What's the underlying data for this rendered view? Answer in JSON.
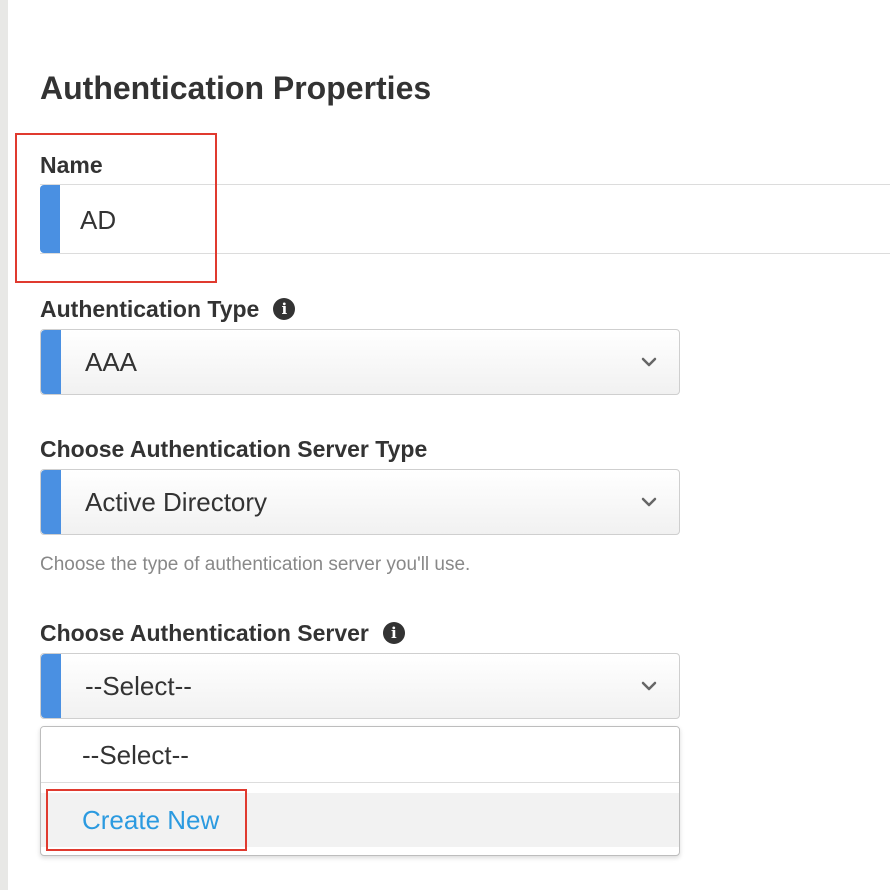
{
  "page": {
    "title": "Authentication Properties"
  },
  "name_field": {
    "label": "Name",
    "value": "AD"
  },
  "auth_type": {
    "label": "Authentication Type",
    "selected": "AAA",
    "info_icon": "info-icon"
  },
  "server_type": {
    "label": "Choose Authentication Server Type",
    "selected": "Active Directory",
    "help": "Choose the type of authentication server you'll use."
  },
  "server": {
    "label": "Choose Authentication Server",
    "selected": "--Select--",
    "info_icon": "info-icon",
    "options": [
      "--Select--",
      "Create New"
    ]
  },
  "colors": {
    "accent": "#4a90e2",
    "highlight": "#e03a2f",
    "link": "#2b9ae0"
  }
}
